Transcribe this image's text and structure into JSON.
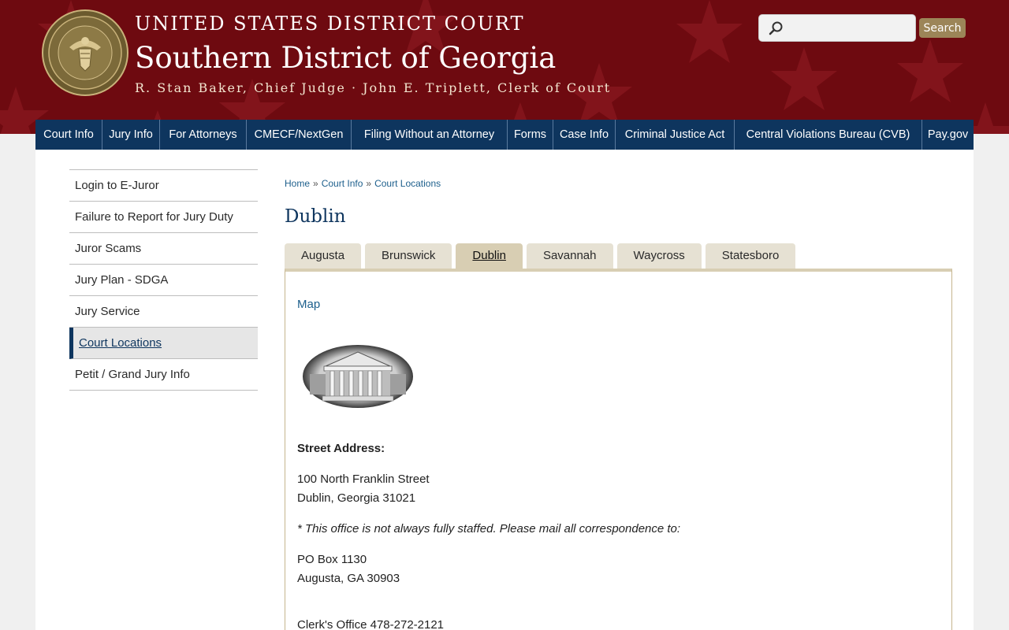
{
  "header": {
    "top_line": "UNITED STATES DISTRICT COURT",
    "title": "Southern District of Georgia",
    "subtitle": "R. Stan Baker, Chief Judge · John E. Triplett, Clerk of Court",
    "seal_icon": "court-seal-icon",
    "seal_text": "UNITED STATES DISTRICT COURT · SOUTHERN DISTRICT OF GEORGIA"
  },
  "search": {
    "placeholder": "",
    "value": "",
    "button": "Search",
    "icon": "search-icon"
  },
  "nav": [
    "Court Info",
    "Jury Info",
    "For Attorneys",
    "CMECF/NextGen",
    "Filing Without an Attorney",
    "Forms",
    "Case Info",
    "Criminal Justice Act",
    "Central Violations Bureau (CVB)",
    "Pay.gov"
  ],
  "sidebar": [
    {
      "label": "Login to E-Juror",
      "active": false
    },
    {
      "label": "Failure to Report for Jury Duty",
      "active": false
    },
    {
      "label": "Juror Scams",
      "active": false
    },
    {
      "label": "Jury Plan - SDGA",
      "active": false
    },
    {
      "label": "Jury Service",
      "active": false
    },
    {
      "label": "Court Locations",
      "active": true
    },
    {
      "label": "Petit / Grand Jury Info",
      "active": false
    }
  ],
  "breadcrumb": [
    "Home",
    "Court Info",
    "Court Locations"
  ],
  "breadcrumb_sep": "»",
  "page_title": "Dublin",
  "tabs": [
    {
      "label": "Augusta",
      "active": false
    },
    {
      "label": "Brunswick",
      "active": false
    },
    {
      "label": "Dublin",
      "active": true
    },
    {
      "label": "Savannah",
      "active": false
    },
    {
      "label": "Waycross",
      "active": false
    },
    {
      "label": "Statesboro",
      "active": false
    }
  ],
  "content": {
    "map_link": "Map",
    "street_label": "Street Address:",
    "street_line1": "100 North Franklin Street",
    "street_line2": "Dublin, Georgia  31021",
    "note": "* This office is not always fully staffed. Please mail all correspondence to:",
    "po_line1": "PO Box 1130",
    "po_line2": "Augusta, GA 30903",
    "phone": "Clerk's Office  478-272-2121"
  },
  "colors": {
    "header_bg": "#6e0a10",
    "nav_bg": "#0e355e",
    "accent_gold": "#9c8558",
    "tab_active": "#d8ceb3",
    "link": "#1d5f8c"
  }
}
